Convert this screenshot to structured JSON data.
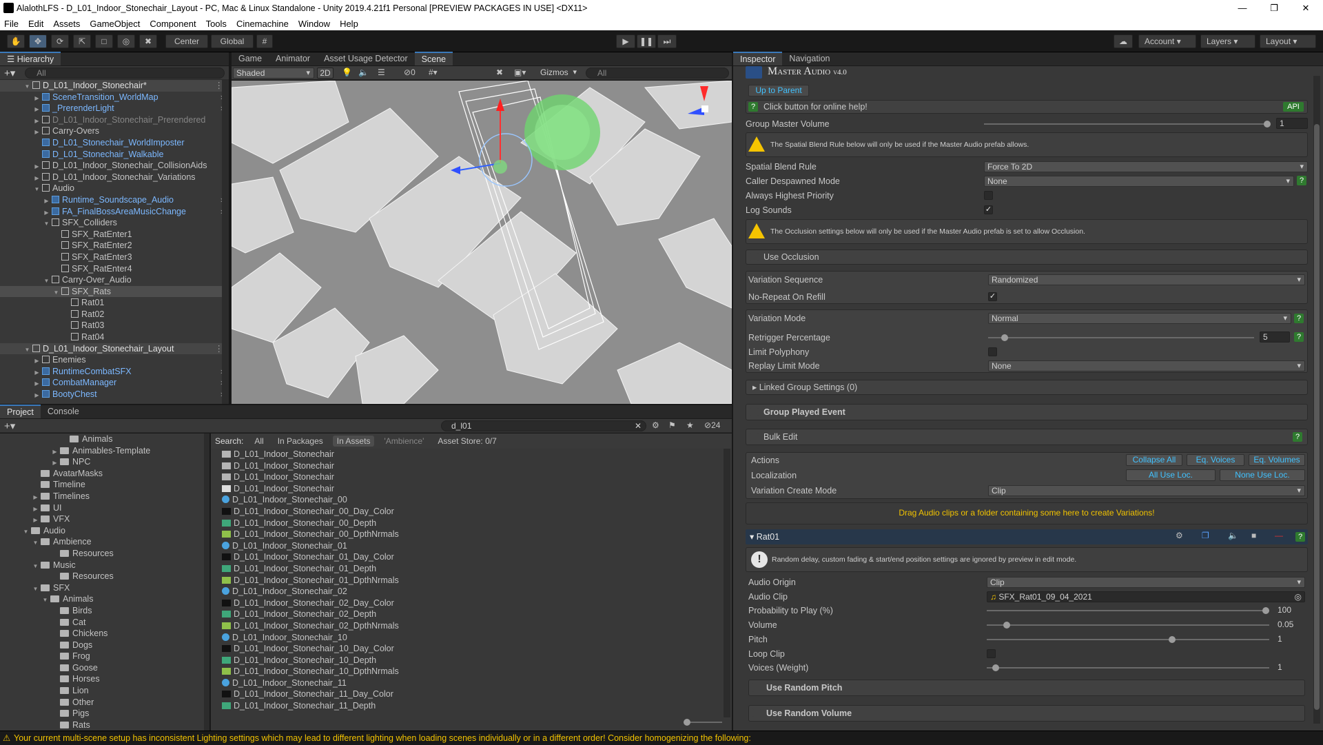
{
  "window": {
    "title": "AlalothLFS - D_L01_Indoor_Stonechair_Layout - PC, Mac & Linux Standalone - Unity 2019.4.21f1 Personal [PREVIEW PACKAGES IN USE] <DX11>",
    "menu": [
      "File",
      "Edit",
      "Assets",
      "GameObject",
      "Component",
      "Tools",
      "Cinemachine",
      "Window",
      "Help"
    ]
  },
  "toolbar": {
    "center_label": "Center",
    "global_label": "Global",
    "account_label": "Account",
    "layers_label": "Layers",
    "layout_label": "Layout"
  },
  "hierarchy": {
    "tab": "Hierarchy",
    "search_placeholder": "All",
    "rows": [
      {
        "text": "D_L01_Indoor_Stonechair*",
        "style": "scene"
      },
      {
        "text": "SceneTransition_WorldMap",
        "style": "blue"
      },
      {
        "text": "_PrerenderLight",
        "style": "blue"
      },
      {
        "text": "D_L01_Indoor_Stonechair_Prerendered",
        "style": "grey"
      },
      {
        "text": "Carry-Overs",
        "style": "normal"
      },
      {
        "text": "D_L01_Stonechair_WorldImposter",
        "style": "blue"
      },
      {
        "text": "D_L01_Stonechair_Walkable",
        "style": "blue"
      },
      {
        "text": "D_L01_Indoor_Stonechair_CollisionAids",
        "style": "normal"
      },
      {
        "text": "D_L01_Indoor_Stonechair_Variations",
        "style": "normal"
      },
      {
        "text": "Audio",
        "style": "normal"
      },
      {
        "text": "Runtime_Soundscape_Audio",
        "style": "blue"
      },
      {
        "text": "FA_FinalBossAreaMusicChange",
        "style": "blue"
      },
      {
        "text": "SFX_Colliders",
        "style": "normal"
      },
      {
        "text": "SFX_RatEnter1",
        "style": "normal"
      },
      {
        "text": "SFX_RatEnter2",
        "style": "normal"
      },
      {
        "text": "SFX_RatEnter3",
        "style": "normal"
      },
      {
        "text": "SFX_RatEnter4",
        "style": "normal"
      },
      {
        "text": "Carry-Over_Audio",
        "style": "normal"
      },
      {
        "text": "SFX_Rats",
        "style": "normal"
      },
      {
        "text": "Rat01",
        "style": "normal"
      },
      {
        "text": "Rat02",
        "style": "normal"
      },
      {
        "text": "Rat03",
        "style": "normal"
      },
      {
        "text": "Rat04",
        "style": "normal"
      },
      {
        "text": "D_L01_Indoor_Stonechair_Layout",
        "style": "scene"
      },
      {
        "text": "Enemies",
        "style": "normal"
      },
      {
        "text": "RuntimeCombatSFX",
        "style": "blue"
      },
      {
        "text": "CombatManager",
        "style": "blue"
      },
      {
        "text": "BootyChest",
        "style": "blue"
      }
    ]
  },
  "scene": {
    "tabs": [
      "Game",
      "Animator",
      "Asset Usage Detector",
      "Scene"
    ],
    "shading": "Shaded",
    "mode_2d": "2D",
    "hidden_count": "0",
    "gizmos": "Gizmos",
    "search_placeholder": "All"
  },
  "project": {
    "tabs": [
      "Project",
      "Console"
    ],
    "search_value": "d_l01",
    "count": "24",
    "search_label": "Search:",
    "filters": [
      "All",
      "In Packages",
      "In Assets",
      "'Ambience'",
      "Asset Store: 0/7"
    ],
    "tree": [
      "Animals",
      "Animables-Template",
      "NPC",
      "AvatarMasks",
      "Timeline",
      "Timelines",
      "UI",
      "VFX",
      "Audio",
      "Ambience",
      "Resources",
      "Music",
      "Resources",
      "SFX",
      "Animals",
      "Birds",
      "Cat",
      "Chickens",
      "Dogs",
      "Frog",
      "Goose",
      "Horses",
      "Lion",
      "Other",
      "Pigs",
      "Rats"
    ],
    "assets": [
      "D_L01_Indoor_Stonechair",
      "D_L01_Indoor_Stonechair",
      "D_L01_Indoor_Stonechair",
      "D_L01_Indoor_Stonechair",
      "D_L01_Indoor_Stonechair_00",
      "D_L01_Indoor_Stonechair_00_Day_Color",
      "D_L01_Indoor_Stonechair_00_Depth",
      "D_L01_Indoor_Stonechair_00_DpthNrmals",
      "D_L01_Indoor_Stonechair_01",
      "D_L01_Indoor_Stonechair_01_Day_Color",
      "D_L01_Indoor_Stonechair_01_Depth",
      "D_L01_Indoor_Stonechair_01_DpthNrmals",
      "D_L01_Indoor_Stonechair_02",
      "D_L01_Indoor_Stonechair_02_Day_Color",
      "D_L01_Indoor_Stonechair_02_Depth",
      "D_L01_Indoor_Stonechair_02_DpthNrmals",
      "D_L01_Indoor_Stonechair_10",
      "D_L01_Indoor_Stonechair_10_Day_Color",
      "D_L01_Indoor_Stonechair_10_Depth",
      "D_L01_Indoor_Stonechair_10_DpthNrmals",
      "D_L01_Indoor_Stonechair_11",
      "D_L01_Indoor_Stonechair_11_Day_Color",
      "D_L01_Indoor_Stonechair_11_Depth"
    ]
  },
  "inspector": {
    "tabs": [
      "Inspector",
      "Navigation"
    ],
    "header_title": "Master Audio",
    "header_version": "v4.0",
    "up_to_parent": "Up to Parent",
    "online_help": "Click button for online help!",
    "api_label": "API",
    "group_master_volume_label": "Group Master Volume",
    "group_master_volume": "1",
    "spatial_warning": "The Spatial Blend Rule below will only be used if the Master Audio prefab allows.",
    "spatial_blend_rule_label": "Spatial Blend Rule",
    "spatial_blend_rule": "Force To 2D",
    "caller_despawned_label": "Caller Despawned Mode",
    "caller_despawned": "None",
    "always_highest_label": "Always Highest Priority",
    "log_sounds_label": "Log Sounds",
    "occlusion_warning": "The Occlusion settings below will only be used if the Master Audio prefab is set to allow Occlusion.",
    "use_occlusion_label": "Use Occlusion",
    "variation_sequence_label": "Variation Sequence",
    "variation_sequence": "Randomized",
    "no_repeat_label": "No-Repeat On Refill",
    "variation_mode_label": "Variation Mode",
    "variation_mode": "Normal",
    "retrigger_label": "Retrigger Percentage",
    "retrigger_value": "5",
    "retrigger_fraction": 0.05,
    "limit_polyphony_label": "Limit Polyphony",
    "replay_limit_label": "Replay Limit Mode",
    "replay_limit": "None",
    "linked_group_label": "Linked Group Settings (0)",
    "group_played_label": "Group Played Event",
    "bulk_edit_label": "Bulk Edit",
    "actions_label": "Actions",
    "collapse_all": "Collapse All",
    "eq_voices": "Eq. Voices",
    "eq_volumes": "Eq. Volumes",
    "localization_label": "Localization",
    "all_use_loc": "All Use Loc.",
    "none_use_loc": "None Use Loc.",
    "variation_create_label": "Variation Create Mode",
    "variation_create": "Clip",
    "drag_hint": "Drag Audio clips or a folder containing some here to create Variations!",
    "variation_name": "Rat01",
    "preview_note": "Random delay, custom fading & start/end position settings are ignored by preview in edit mode.",
    "audio_origin_label": "Audio Origin",
    "audio_origin": "Clip",
    "audio_clip_label": "Audio Clip",
    "audio_clip": "SFX_Rat01_09_04_2021",
    "probability_label": "Probability to Play (%)",
    "probability": "100",
    "volume_label": "Volume",
    "volume": "0.05",
    "pitch_label": "Pitch",
    "pitch": "1",
    "loop_clip_label": "Loop Clip",
    "voices_label": "Voices (Weight)",
    "voices": "1",
    "random_pitch_label": "Use Random Pitch",
    "random_volume_label": "Use Random Volume",
    "probability_fraction": 1.0,
    "volume_fraction": 0.06,
    "pitch_fraction": 0.66,
    "voices_fraction": 0.02,
    "group_master_fraction": 1.0
  },
  "status": {
    "message": "Your current multi-scene setup has inconsistent Lighting settings which may lead to different lighting when loading scenes individually or in a different order! Consider homogenizing the following:"
  },
  "colors": {
    "accent": "#3a79bb",
    "link": "#41c2ff",
    "warning": "#f5c400"
  }
}
